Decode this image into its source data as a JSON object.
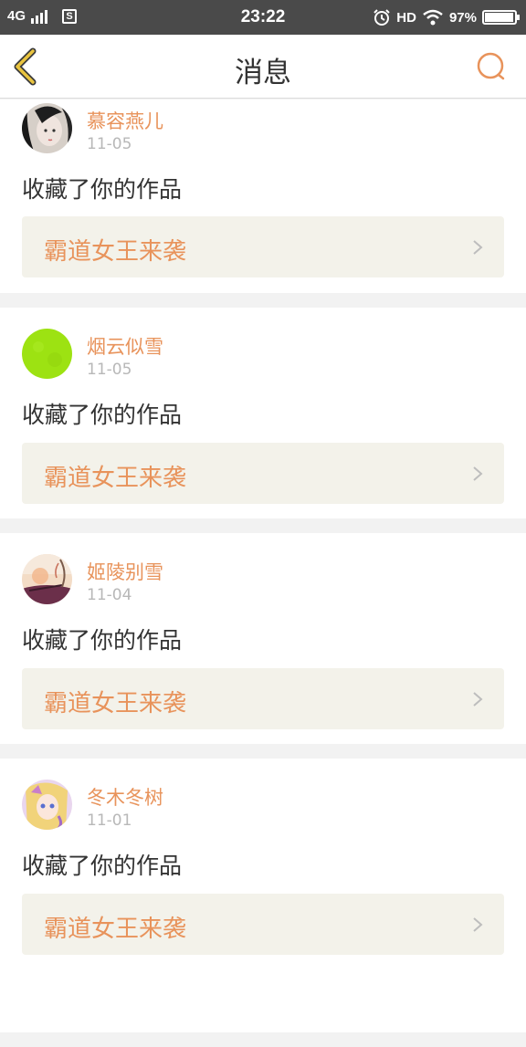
{
  "status_bar": {
    "network": "4G",
    "sim": "S",
    "time": "23:22",
    "hd": "HD",
    "battery": "97%",
    "battery_level": 0.97
  },
  "header": {
    "title": "消息",
    "back_icon": "chevron-left-icon",
    "search_icon": "search-icon"
  },
  "colors": {
    "accent": "#e8935b",
    "back": "#e9c43f",
    "card_bg": "#f3f2ea"
  },
  "messages": [
    {
      "user": "慕容燕儿",
      "date": "11-05",
      "action": "收藏了你的作品",
      "work": "霸道女王来袭"
    },
    {
      "user": "烟云似雪",
      "date": "11-05",
      "action": "收藏了你的作品",
      "work": "霸道女王来袭"
    },
    {
      "user": "姬陵别雪",
      "date": "11-04",
      "action": "收藏了你的作品",
      "work": "霸道女王来袭"
    },
    {
      "user": "冬木冬树",
      "date": "11-01",
      "action": "收藏了你的作品",
      "work": "霸道女王来袭"
    }
  ]
}
